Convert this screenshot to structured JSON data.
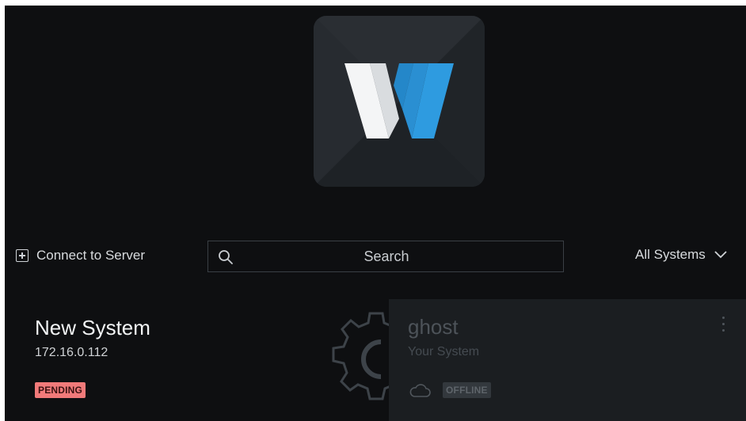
{
  "logo": {
    "letter": "W",
    "icon": "w-logo-icon",
    "tile_color": "#24282c",
    "accent": "#2e9be0"
  },
  "toolbar": {
    "connect_label": "Connect to Server",
    "connect_icon": "plus-square-icon",
    "search_placeholder": "Search",
    "search_icon": "search-icon",
    "filter_label": "All Systems",
    "filter_icon": "chevron-down-icon"
  },
  "systems": [
    {
      "name": "New System",
      "address": "172.16.0.112",
      "status": "PENDING",
      "status_color": "#f07a7a"
    },
    {
      "name": "ghost",
      "description": "Your System",
      "status": "OFFLINE",
      "icon": "cloud-icon",
      "menu_icon": "more-vertical-icon"
    }
  ],
  "colors": {
    "background": "#0e0f11",
    "card": "#1b1e21",
    "text": "#e6e8ea"
  }
}
